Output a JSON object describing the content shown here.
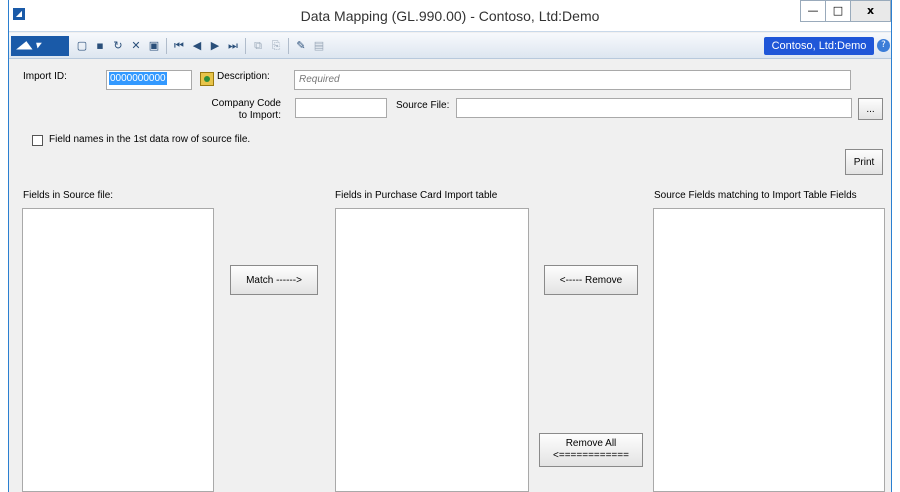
{
  "window": {
    "title": "Data Mapping (GL.990.00) - Contoso, Ltd:Demo",
    "minimize": "—",
    "maximize": "□",
    "close": "x"
  },
  "toolbar": {
    "company": "Contoso, Ltd:Demo",
    "icons": [
      "menu-logo-icon",
      "new-icon",
      "save-icon",
      "refresh-icon",
      "delete-icon",
      "save-close-icon",
      "first-icon",
      "previous-icon",
      "next-icon",
      "last-icon",
      "copy-icon",
      "paste-icon",
      "note-icon",
      "attach-icon",
      "help-icon"
    ]
  },
  "form": {
    "import_id_label": "Import ID:",
    "import_id_value": "0000000000",
    "description_label": "Description:",
    "description_placeholder": "Required",
    "company_code_label_line1": "Company Code",
    "company_code_label_line2": "to Import:",
    "company_code_value": "",
    "source_file_label": "Source File:",
    "source_file_value": "",
    "browse_label": "...",
    "field_names_checkbox_label": "Field names in the 1st data row of source file.",
    "field_names_checked": false,
    "print_label": "Print"
  },
  "lists": {
    "source_fields_label": "Fields in Source file:",
    "import_table_label": "Fields in Purchase Card Import table",
    "matched_label": "Source Fields matching to Import Table  Fields"
  },
  "actions": {
    "match_label": "Match ------>",
    "remove_label": "<----- Remove",
    "remove_all_line1": "Remove All",
    "remove_all_line2": "<============"
  }
}
